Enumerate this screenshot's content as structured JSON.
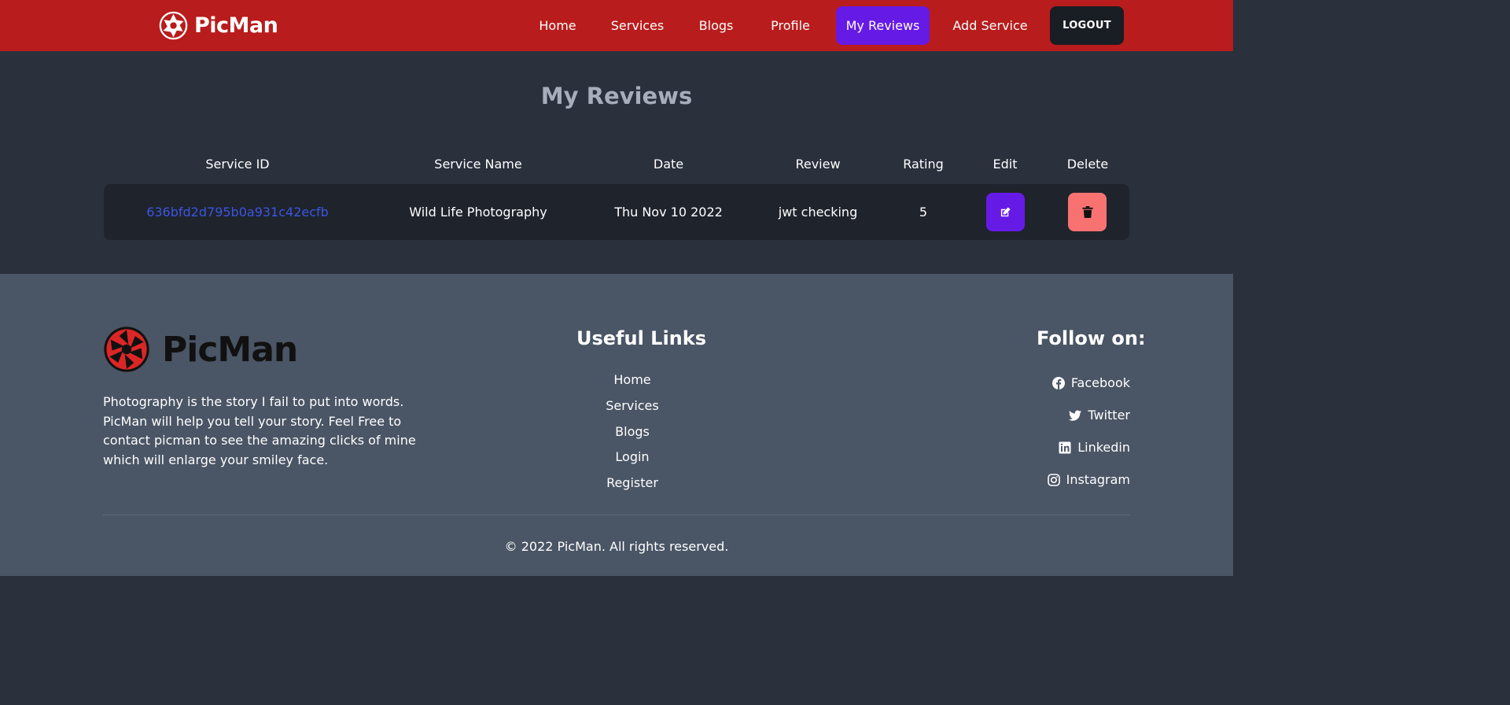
{
  "nav": {
    "brand": "PicMan",
    "items": [
      {
        "label": "Home"
      },
      {
        "label": "Services"
      },
      {
        "label": "Blogs"
      },
      {
        "label": "Profile"
      },
      {
        "label": "My Reviews",
        "active": true
      },
      {
        "label": "Add Service"
      }
    ],
    "logout": "LOGOUT"
  },
  "main": {
    "title": "My Reviews",
    "table": {
      "headers": [
        "Service ID",
        "Service Name",
        "Date",
        "Review",
        "Rating",
        "Edit",
        "Delete"
      ],
      "rows": [
        {
          "service_id": "636bfd2d795b0a931c42ecfb",
          "service_name": "Wild Life Photography",
          "date": "Thu Nov 10 2022",
          "review": "jwt checking",
          "rating": "5",
          "edit_icon": "edit-icon",
          "delete_icon": "trash-icon"
        }
      ]
    }
  },
  "footer": {
    "brand": "PicMan",
    "description": "Photography is the story I fail to put into words. PicMan will help you tell your story. Feel Free to contact picman to see the amazing clicks of mine which will enlarge your smiley face.",
    "useful_links_title": "Useful Links",
    "useful_links": [
      "Home",
      "Services",
      "Blogs",
      "Login",
      "Register"
    ],
    "follow_title": "Follow on:",
    "social": [
      {
        "label": "Facebook",
        "icon": "facebook-icon"
      },
      {
        "label": "Twitter",
        "icon": "twitter-icon"
      },
      {
        "label": "Linkedin",
        "icon": "linkedin-icon"
      },
      {
        "label": "Instagram",
        "icon": "instagram-icon"
      }
    ],
    "copyright": "© 2022 PicMan. All rights reserved."
  },
  "colors": {
    "navbar": "#b91c1c",
    "primary": "#661ae6",
    "error": "#f87272",
    "page_bg": "#2a303c",
    "footer_bg": "#4a5565"
  }
}
